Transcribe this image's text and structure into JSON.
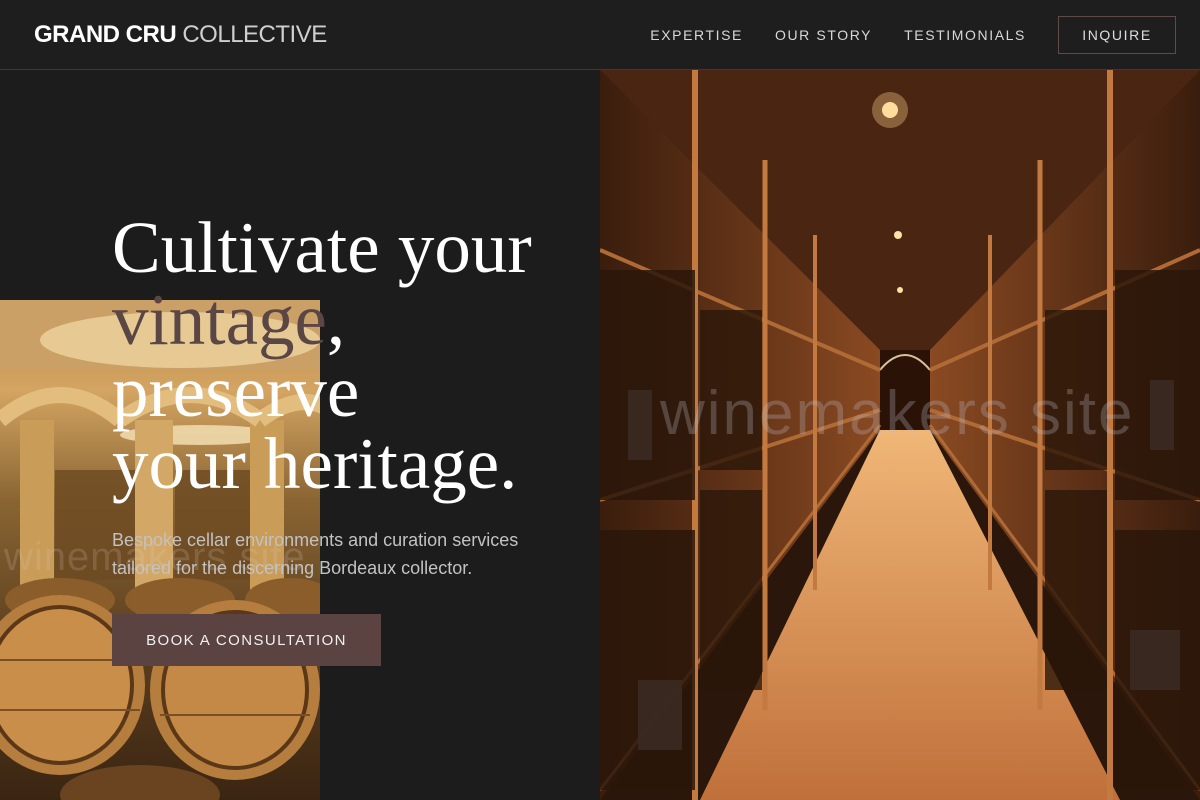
{
  "header": {
    "logo_strong": "GRAND CRU",
    "logo_light": "COLLECTIVE",
    "nav": [
      "EXPERTISE",
      "OUR STORY",
      "TESTIMONIALS"
    ],
    "inquire_label": "INQUIRE"
  },
  "hero": {
    "title_line1": "Cultivate your",
    "title_line2": "vintage",
    "title_comma": ",",
    "title_line3": "preserve",
    "title_line4": "your heritage.",
    "subtitle": "Bespoke cellar environments and curation services tailored for the discerning Bordeaux collector.",
    "cta_label": "BOOK A CONSULTATION"
  },
  "watermark": "winemakers site",
  "colors": {
    "background": "#1b1b1b",
    "accent": "#5b4341",
    "muted_title": "#5a4644",
    "text": "#ffffff",
    "subtext": "#c2c2c2"
  },
  "images": [
    {
      "name": "barrel-room-photo",
      "description_icon": "wine-barrels"
    },
    {
      "name": "wine-cellar-corridor-photo",
      "description_icon": "wine-cellar"
    }
  ]
}
